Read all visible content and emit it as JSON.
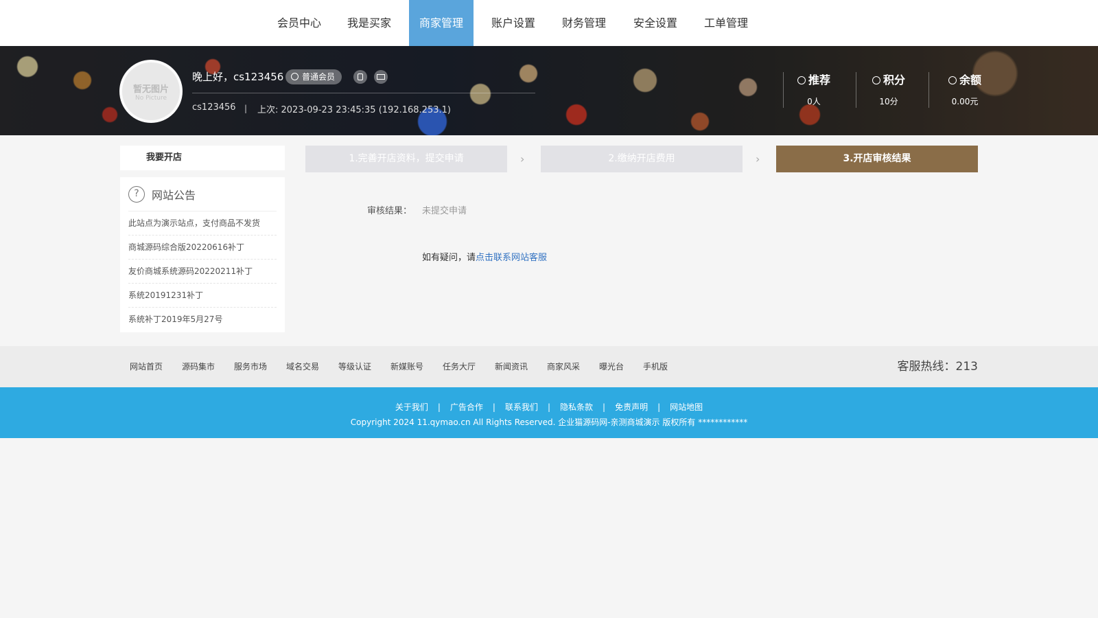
{
  "nav": {
    "items": [
      "会员中心",
      "我是买家",
      "商家管理",
      "账户设置",
      "财务管理",
      "安全设置",
      "工单管理"
    ],
    "active": "商家管理"
  },
  "profile": {
    "avatar_text_1": "暂无图片",
    "avatar_text_2": "No Picture",
    "greeting": "晚上好，cs123456",
    "level": "普通会员",
    "user_id": "cs123456",
    "separator": "|",
    "last_login": "上次: 2023-09-23 23:45:35 (192.168.253.1)"
  },
  "stats": [
    {
      "label": "推荐",
      "value": "0人",
      "icon": "phone-icon"
    },
    {
      "label": "积分",
      "value": "10分",
      "icon": "coins-icon"
    },
    {
      "label": "余额",
      "value": "0.00元",
      "icon": "yen-icon"
    }
  ],
  "sidebar": {
    "title": "我要开店",
    "notice_title": "网站公告",
    "notices": [
      "此站点为演示站点，支付商品不发货",
      "商城源码综合版20220616补丁",
      "友价商城系统源码20220211补丁",
      "系统20191231补丁",
      "系统补丁2019年5月27号"
    ]
  },
  "steps": [
    {
      "label": "1.完善开店资料，提交申请",
      "state": "done"
    },
    {
      "label": "2.缴纳开店费用",
      "state": "done"
    },
    {
      "label": "3.开店审核结果",
      "state": "current"
    }
  ],
  "step_arrow": "›",
  "result": {
    "label": "审核结果：",
    "value": "未提交申请",
    "help_prefix": "如有疑问，请",
    "help_link": "点击联系网站客服"
  },
  "footer": {
    "links": [
      "网站首页",
      "源码集市",
      "服务市场",
      "域名交易",
      "等级认证",
      "新媒账号",
      "任务大厅",
      "新闻资讯",
      "商家风采",
      "曝光台",
      "手机版"
    ],
    "hotline": "客服热线：213",
    "bottom_links": [
      "关于我们",
      "广告合作",
      "联系我们",
      "隐私条款",
      "免责声明",
      "网站地图"
    ],
    "pipe": "|",
    "copyright": "Copyright 2024 11.qymao.cn All Rights Reserved. 企业猫源码网-亲测商城演示   版权所有    ************"
  },
  "colors": {
    "nav_active": "#5aa5dc",
    "step_current": "#8a6d48",
    "step_done": "#e2e2e6",
    "footer_blue": "#2eaae1",
    "link": "#3373c2"
  }
}
